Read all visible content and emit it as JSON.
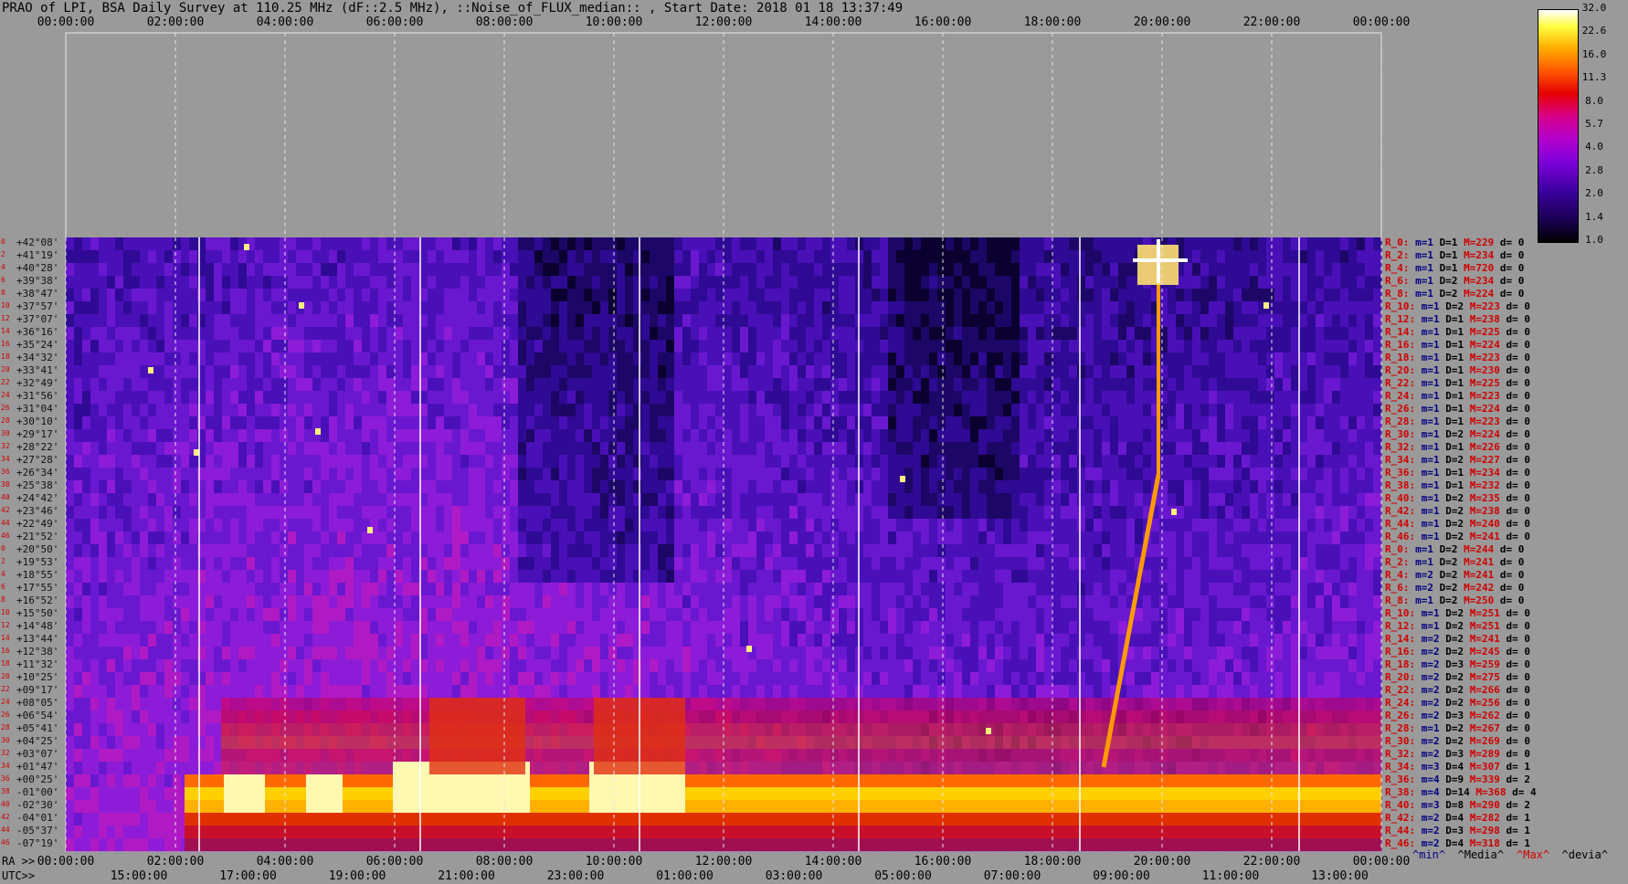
{
  "title": "PRAO of LPI, BSA Daily Survey at 110.25 MHz (dF::2.5 MHz), ::Noise_of_FLUX_median:: , Start Date: 2018 01 18 13:37:49",
  "chart_data": {
    "type": "heatmap",
    "x_top_ticks": [
      "00:00:00",
      "02:00:00",
      "04:00:00",
      "06:00:00",
      "08:00:00",
      "10:00:00",
      "12:00:00",
      "14:00:00",
      "16:00:00",
      "18:00:00",
      "20:00:00",
      "22:00:00",
      "00:00:00"
    ],
    "x_bottom_ra_label": "RA >>",
    "x_bottom_ra_ticks": [
      "00:00:00",
      "02:00:00",
      "04:00:00",
      "06:00:00",
      "08:00:00",
      "10:00:00",
      "12:00:00",
      "14:00:00",
      "16:00:00",
      "18:00:00",
      "20:00:00",
      "22:00:00",
      "00:00:00"
    ],
    "x_bottom_utc_label": "UTC>>",
    "x_bottom_utc_ticks": [
      "15:00:00",
      "17:00:00",
      "19:00:00",
      "21:00:00",
      "23:00:00",
      "01:00:00",
      "03:00:00",
      "05:00:00",
      "07:00:00",
      "09:00:00",
      "11:00:00",
      "13:00:00"
    ],
    "declinations": [
      "+42°08'",
      "+41°19'",
      "+40°28'",
      "+39°38'",
      "+38°47'",
      "+37°57'",
      "+37°07'",
      "+36°16'",
      "+35°24'",
      "+34°32'",
      "+33°41'",
      "+32°49'",
      "+31°56'",
      "+31°04'",
      "+30°10'",
      "+29°17'",
      "+28°22'",
      "+27°28'",
      "+26°34'",
      "+25°38'",
      "+24°42'",
      "+23°46'",
      "+22°49'",
      "+21°52'",
      "+20°50'",
      "+19°53'",
      "+18°55'",
      "+17°55'",
      "+16°52'",
      "+15°50'",
      "+14°48'",
      "+13°44'",
      "+12°38'",
      "+11°32'",
      "+10°25'",
      "+09°17'",
      "+08°05'",
      "+06°54'",
      "+05°41'",
      "+04°25'",
      "+03°07'",
      "+01°47'",
      "+00°25'",
      "-01°00'",
      "-02°30'",
      "-04°01'",
      "-05°37'",
      "-07°19'"
    ],
    "beam_indices": [
      "0",
      "2",
      "4",
      "6",
      "8",
      "10",
      "12",
      "14",
      "16",
      "18",
      "20",
      "22",
      "24",
      "26",
      "28",
      "30",
      "32",
      "34",
      "36",
      "38",
      "40",
      "42",
      "44",
      "46",
      "0",
      "2",
      "4",
      "6",
      "8",
      "10",
      "12",
      "14",
      "16",
      "18",
      "20",
      "22",
      "24",
      "26",
      "28",
      "30",
      "32",
      "34",
      "36",
      "38",
      "40",
      "42",
      "44",
      "46"
    ],
    "stats_rows": [
      {
        "name": "R_0:",
        "m": 1,
        "D": 1,
        "M": 229,
        "d": 0
      },
      {
        "name": "R_2:",
        "m": 1,
        "D": 1,
        "M": 234,
        "d": 0
      },
      {
        "name": "R_4:",
        "m": 1,
        "D": 1,
        "M": 720,
        "d": 0
      },
      {
        "name": "R_6:",
        "m": 1,
        "D": 2,
        "M": 234,
        "d": 0
      },
      {
        "name": "R_8:",
        "m": 1,
        "D": 2,
        "M": 224,
        "d": 0
      },
      {
        "name": "R_10:",
        "m": 1,
        "D": 2,
        "M": 223,
        "d": 0
      },
      {
        "name": "R_12:",
        "m": 1,
        "D": 1,
        "M": 238,
        "d": 0
      },
      {
        "name": "R_14:",
        "m": 1,
        "D": 1,
        "M": 225,
        "d": 0
      },
      {
        "name": "R_16:",
        "m": 1,
        "D": 1,
        "M": 224,
        "d": 0
      },
      {
        "name": "R_18:",
        "m": 1,
        "D": 1,
        "M": 223,
        "d": 0
      },
      {
        "name": "R_20:",
        "m": 1,
        "D": 1,
        "M": 230,
        "d": 0
      },
      {
        "name": "R_22:",
        "m": 1,
        "D": 1,
        "M": 225,
        "d": 0
      },
      {
        "name": "R_24:",
        "m": 1,
        "D": 1,
        "M": 223,
        "d": 0
      },
      {
        "name": "R_26:",
        "m": 1,
        "D": 1,
        "M": 224,
        "d": 0
      },
      {
        "name": "R_28:",
        "m": 1,
        "D": 1,
        "M": 223,
        "d": 0
      },
      {
        "name": "R_30:",
        "m": 1,
        "D": 2,
        "M": 224,
        "d": 0
      },
      {
        "name": "R_32:",
        "m": 1,
        "D": 1,
        "M": 226,
        "d": 0
      },
      {
        "name": "R_34:",
        "m": 1,
        "D": 2,
        "M": 227,
        "d": 0
      },
      {
        "name": "R_36:",
        "m": 1,
        "D": 1,
        "M": 234,
        "d": 0
      },
      {
        "name": "R_38:",
        "m": 1,
        "D": 1,
        "M": 232,
        "d": 0
      },
      {
        "name": "R_40:",
        "m": 1,
        "D": 2,
        "M": 235,
        "d": 0
      },
      {
        "name": "R_42:",
        "m": 1,
        "D": 2,
        "M": 238,
        "d": 0
      },
      {
        "name": "R_44:",
        "m": 1,
        "D": 2,
        "M": 240,
        "d": 0
      },
      {
        "name": "R_46:",
        "m": 1,
        "D": 2,
        "M": 241,
        "d": 0
      },
      {
        "name": "R_0:",
        "m": 1,
        "D": 2,
        "M": 244,
        "d": 0
      },
      {
        "name": "R_2:",
        "m": 1,
        "D": 2,
        "M": 241,
        "d": 0
      },
      {
        "name": "R_4:",
        "m": 2,
        "D": 2,
        "M": 241,
        "d": 0
      },
      {
        "name": "R_6:",
        "m": 2,
        "D": 2,
        "M": 242,
        "d": 0
      },
      {
        "name": "R_8:",
        "m": 1,
        "D": 2,
        "M": 250,
        "d": 0
      },
      {
        "name": "R_10:",
        "m": 1,
        "D": 2,
        "M": 251,
        "d": 0
      },
      {
        "name": "R_12:",
        "m": 1,
        "D": 2,
        "M": 251,
        "d": 0
      },
      {
        "name": "R_14:",
        "m": 2,
        "D": 2,
        "M": 241,
        "d": 0
      },
      {
        "name": "R_16:",
        "m": 2,
        "D": 2,
        "M": 245,
        "d": 0
      },
      {
        "name": "R_18:",
        "m": 2,
        "D": 3,
        "M": 259,
        "d": 0
      },
      {
        "name": "R_20:",
        "m": 2,
        "D": 2,
        "M": 275,
        "d": 0
      },
      {
        "name": "R_22:",
        "m": 2,
        "D": 2,
        "M": 266,
        "d": 0
      },
      {
        "name": "R_24:",
        "m": 2,
        "D": 2,
        "M": 256,
        "d": 0
      },
      {
        "name": "R_26:",
        "m": 2,
        "D": 3,
        "M": 262,
        "d": 0
      },
      {
        "name": "R_28:",
        "m": 1,
        "D": 2,
        "M": 267,
        "d": 0
      },
      {
        "name": "R_30:",
        "m": 2,
        "D": 2,
        "M": 269,
        "d": 0
      },
      {
        "name": "R_32:",
        "m": 2,
        "D": 3,
        "M": 289,
        "d": 0
      },
      {
        "name": "R_34:",
        "m": 3,
        "D": 4,
        "M": 307,
        "d": 1
      },
      {
        "name": "R_36:",
        "m": 4,
        "D": 9,
        "M": 339,
        "d": 2
      },
      {
        "name": "R_38:",
        "m": 4,
        "D": 14,
        "M": 368,
        "d": 4
      },
      {
        "name": "R_40:",
        "m": 3,
        "D": 8,
        "M": 290,
        "d": 2
      },
      {
        "name": "R_42:",
        "m": 2,
        "D": 4,
        "M": 282,
        "d": 1
      },
      {
        "name": "R_44:",
        "m": 2,
        "D": 3,
        "M": 298,
        "d": 1
      },
      {
        "name": "R_46:",
        "m": 2,
        "D": 4,
        "M": 318,
        "d": 1
      }
    ],
    "colorbar": {
      "ticks": [
        "32.0",
        "22.6",
        "16.0",
        "11.3",
        "8.0",
        "5.7",
        "4.0",
        "2.8",
        "2.0",
        "1.4",
        "1.0"
      ]
    },
    "legend_footer": [
      {
        "text": "^min^",
        "color": "#000080"
      },
      {
        "text": "^Media^",
        "color": "#000000"
      },
      {
        "text": "^Max^",
        "color": "#d00000"
      },
      {
        "text": "^devia^",
        "color": "#000000"
      }
    ]
  }
}
